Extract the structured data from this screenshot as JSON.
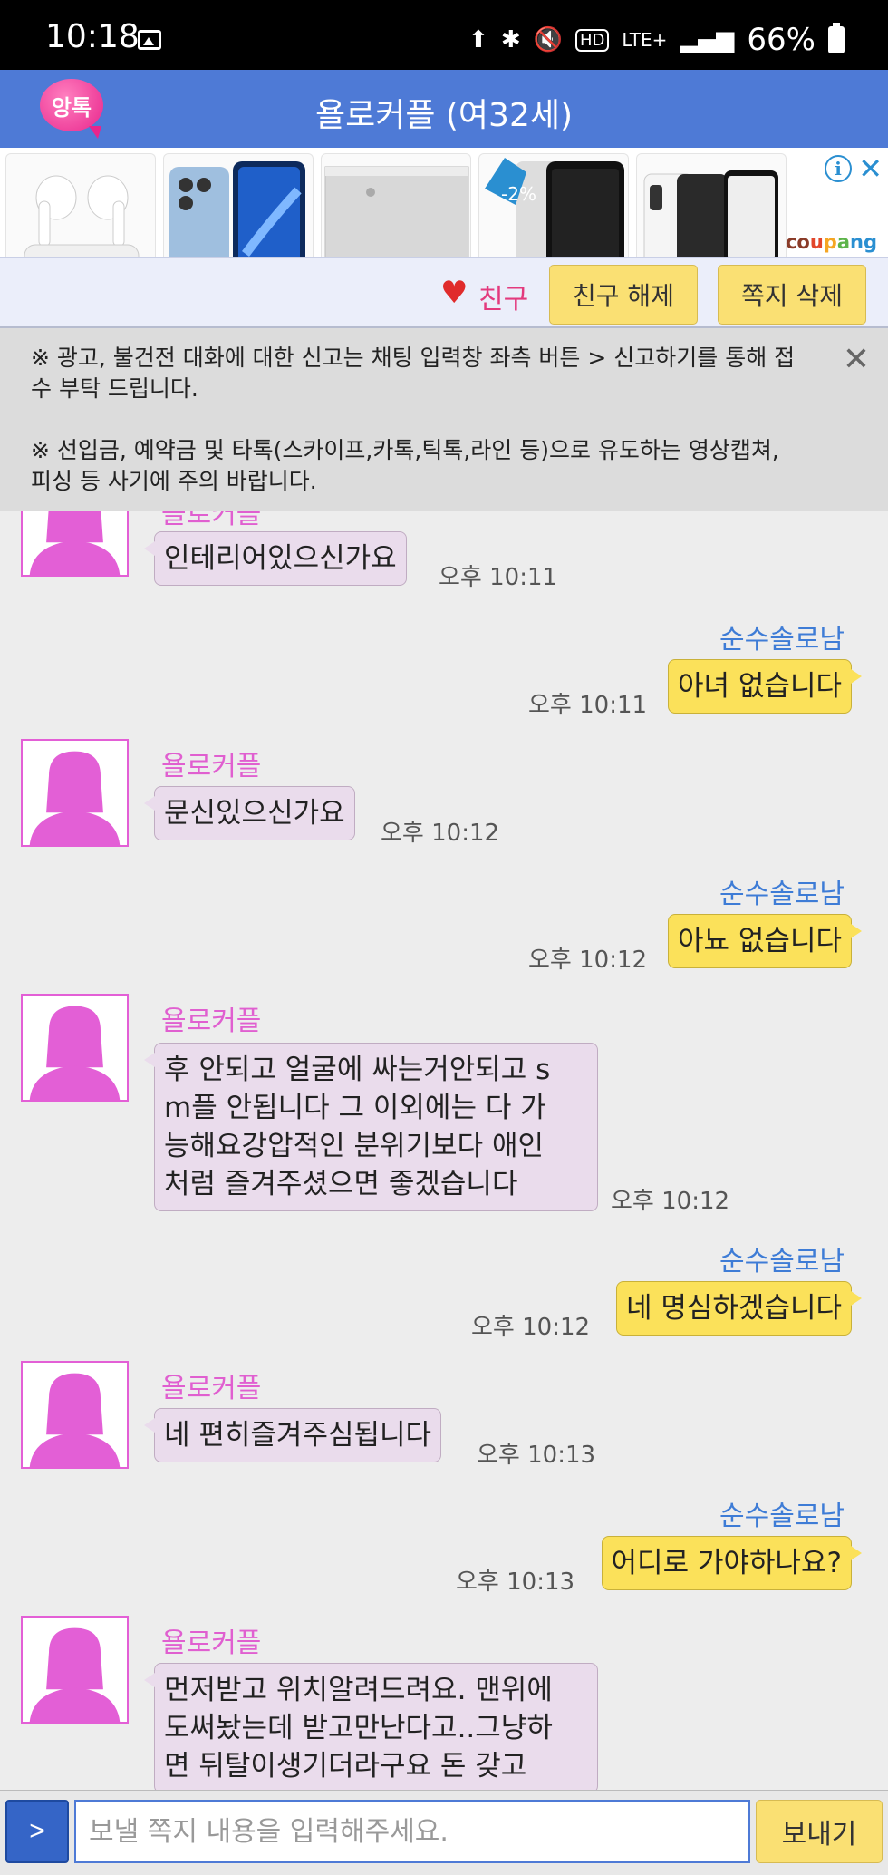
{
  "status_bar": {
    "time": "10:18",
    "battery": "66%",
    "icons": [
      "image-icon",
      "upload-icon",
      "bluetooth-icon",
      "mute-icon",
      "hd-icon",
      "lte-icon",
      "signal-icon",
      "battery-icon"
    ],
    "hd": "HD",
    "lte": "LTE+"
  },
  "header": {
    "logo_text": "앙톡",
    "title": "욜로커플 (여32세)"
  },
  "ad": {
    "discount": "-2%",
    "brand": [
      "co",
      "u",
      "p",
      "a",
      "ng"
    ],
    "info": "i",
    "close": "✕"
  },
  "friend_bar": {
    "status_label": "친구",
    "unfriend_button": "친구 해제",
    "delete_button": "쪽지 삭제"
  },
  "notice": {
    "line1": "※ 광고, 불건전 대화에 대한 신고는 채팅 입력창 좌측 버튼 > 신고하기를 통해 접수 부탁 드립니다.",
    "line2": "※ 선입금, 예약금 및 타톡(스카이프,카톡,틱톡,라인 등)으로 유도하는 영상캡쳐,피싱 등 사기에 주의 바랍니다.",
    "close": "✕"
  },
  "messages": [
    {
      "from": "female",
      "sender": "욜로커플",
      "text": "인테리어있으신가요",
      "time": "오후 10:11"
    },
    {
      "from": "male",
      "sender": "순수솔로남",
      "text": "아녀 없습니다",
      "time": "오후 10:11"
    },
    {
      "from": "female",
      "sender": "욜로커플",
      "text": "문신있으신가요",
      "time": "오후 10:12"
    },
    {
      "from": "male",
      "sender": "순수솔로남",
      "text": "아뇨 없습니다",
      "time": "오후 10:12"
    },
    {
      "from": "female",
      "sender": "욜로커플",
      "lines": [
        "후 안되고 얼굴에 싸는거안되고 s",
        "m플 안됩니다 그 이외에는 다 가",
        "능해요강압적인 분위기보다 애인",
        "처럼 즐겨주셨으면 좋겠습니다"
      ],
      "time": "오후 10:12"
    },
    {
      "from": "male",
      "sender": "순수솔로남",
      "text": "네 명심하겠습니다",
      "time": "오후 10:12"
    },
    {
      "from": "female",
      "sender": "욜로커플",
      "text": "네 편히즐겨주심됩니다",
      "time": "오후 10:13"
    },
    {
      "from": "male",
      "sender": "순수솔로남",
      "text": "어디로 가야하나요?",
      "time": "오후 10:13"
    },
    {
      "from": "female",
      "sender": "욜로커플",
      "lines": [
        "먼저받고 위치알려드려요. 맨위에",
        "도써놨는데 받고만난다고..그냥하",
        "면 뒤탈이생기더라구요 돈 갖고"
      ],
      "time": ""
    }
  ],
  "input": {
    "toggle": ">",
    "placeholder": "보낼 쪽지 내용을 입력해주세요.",
    "send_button": "보내기"
  }
}
